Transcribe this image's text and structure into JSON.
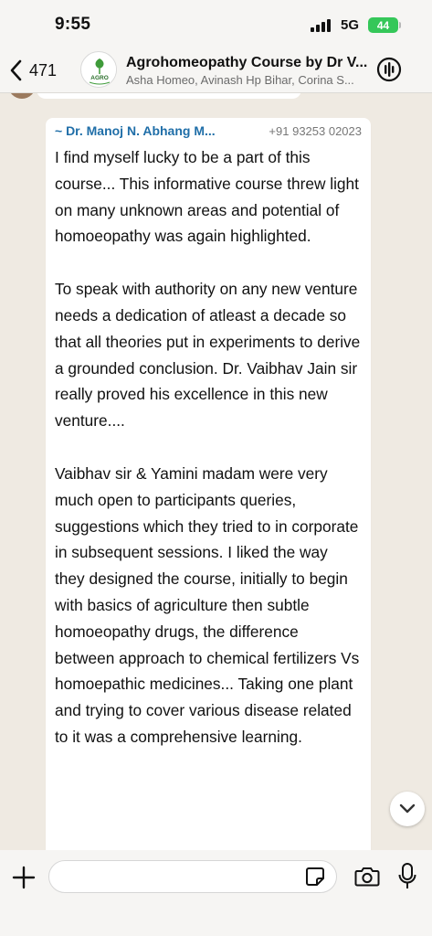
{
  "status_bar": {
    "time": "9:55",
    "network": "5G",
    "battery": "44"
  },
  "header": {
    "back_count": "471",
    "group_title": "Agrohomeopathy Course by Dr V...",
    "group_subtitle": "Asha Homeo, Avinash Hp Bihar, Corina S...",
    "avatar_text": "AGRO"
  },
  "message": {
    "sender_name": "~ Dr. Manoj N. Abhang M...",
    "sender_phone": "+91 93253 02023",
    "paragraphs": [
      "I find myself lucky to be a part of this course... This informative course threw light on many unknown areas and potential of homoeopathy was again highlighted.",
      "To speak with authority on any new venture needs a dedication of atleast a decade so that all theories put in experiments to derive a grounded conclusion. Dr. Vaibhav Jain sir really proved his excellence in this new venture....",
      "Vaibhav sir & Yamini madam were very much open to participants queries, suggestions which they tried to in corporate in subsequent sessions. I liked the way they designed the course, initially to begin with basics of agriculture then subtle homoeopathy drugs, the difference between approach to chemical fertilizers Vs homoepathic medicines... Taking one plant and trying to cover various disease related to it was a comprehensive learning."
    ]
  },
  "composer": {
    "input_value": "",
    "input_placeholder": ""
  },
  "colors": {
    "chat_background": "#efeae2",
    "sender_name": "#1f6ea8",
    "battery": "#35c759"
  },
  "icons": [
    "signal-icon",
    "battery-icon",
    "back-chevron-icon",
    "group-avatar-logo",
    "voice-call-icon",
    "chevron-down-icon",
    "plus-icon",
    "sticker-icon",
    "camera-icon",
    "microphone-icon"
  ]
}
